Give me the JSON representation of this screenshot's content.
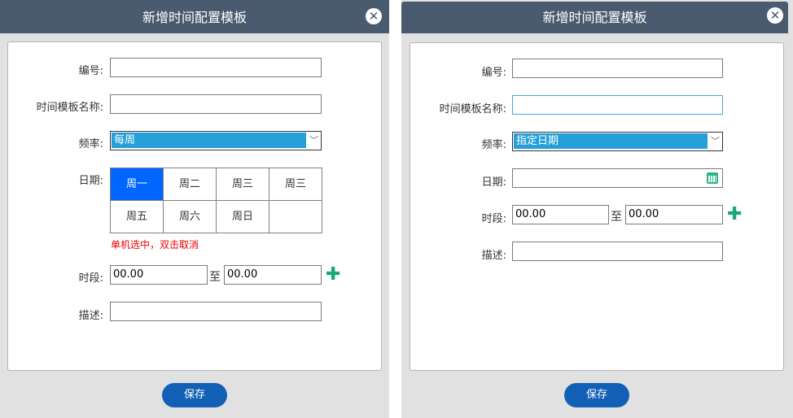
{
  "left_dialog": {
    "title": "新增时间配置模板",
    "close_icon": "close-circle-icon",
    "labels": {
      "code": "编号:",
      "name": "时间模板名称:",
      "frequency": "频率:",
      "date": "日期:",
      "period": "时段:",
      "desc": "描述:"
    },
    "code": "",
    "name": "",
    "frequency": "每周",
    "days": [
      "周一",
      "周二",
      "周三",
      "周三",
      "周五",
      "周六",
      "周日",
      ""
    ],
    "selected_day": "周一",
    "hint": "单机选中，双击取消",
    "period_from": "00.00",
    "to": "至",
    "period_to": "00.00",
    "desc": "",
    "save": "保存"
  },
  "right_dialog": {
    "title": "新增时间配置模板",
    "close_icon": "close-circle-icon",
    "labels": {
      "code": "编号:",
      "name": "时间模板名称:",
      "frequency": "频率:",
      "date": "日期:",
      "period": "时段:",
      "desc": "描述:"
    },
    "code": "",
    "name": "",
    "frequency": "指定日期",
    "date": "",
    "period_from": "00.00",
    "to": "至",
    "period_to": "00.00",
    "desc": "",
    "save": "保存"
  }
}
